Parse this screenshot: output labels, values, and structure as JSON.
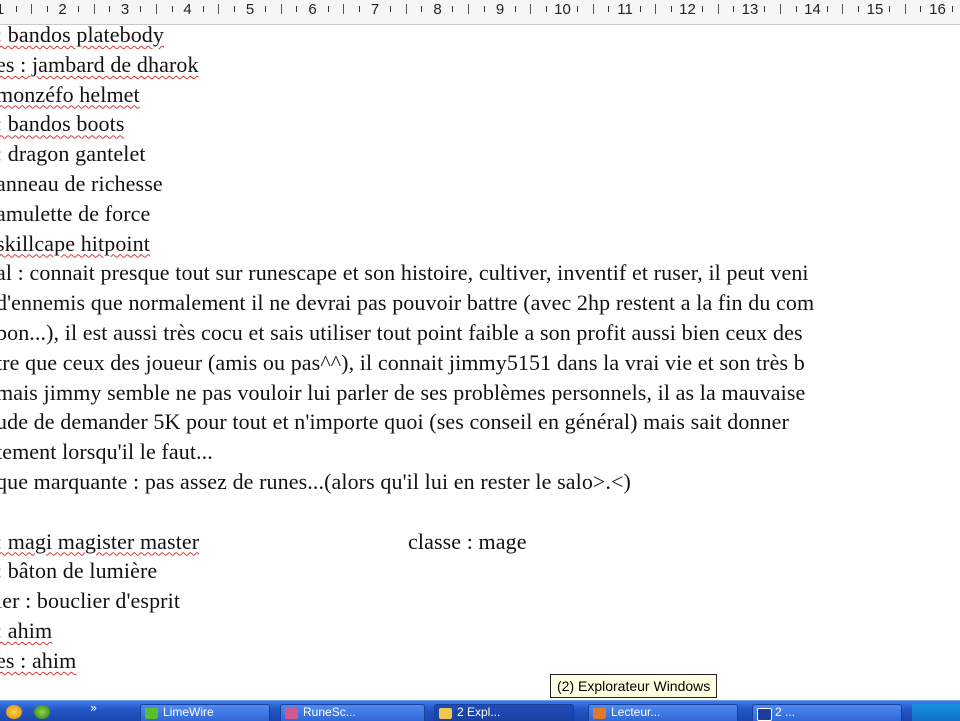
{
  "ruler": {
    "numbers": [
      "1",
      "2",
      "3",
      "4",
      "5",
      "6",
      "7",
      "8",
      "9",
      "10",
      "11",
      "12",
      "13",
      "14",
      "15",
      "16"
    ]
  },
  "document": {
    "lines": [
      {
        "text": ": bandos platebody",
        "squig": true
      },
      {
        "text": "es : jambard de dharok",
        "squig": true
      },
      {
        "text": "monzéfo helmet",
        "squig": true
      },
      {
        "text": ": bandos boots",
        "squig": true
      },
      {
        "text": ": dragon gantelet",
        "squig": false
      },
      {
        "text": "anneau de richesse",
        "squig": false
      },
      {
        "text": "amulette de force",
        "squig": false
      },
      {
        "text": "skillcape hitpoint",
        "squig": true
      },
      {
        "text": "al : connait presque tout sur runescape et son histoire, cultiver, inventif et ruser, il peut veni",
        "squig": false
      },
      {
        "text": "d'ennemis que normalement il ne devrai pas pouvoir battre (avec 2hp restent a la fin du com",
        "squig": false
      },
      {
        "text": "bon...), il est aussi très cocu et sais utiliser tout point faible a son profit aussi bien ceux des",
        "squig": false
      },
      {
        "text": "tre que ceux des joueur (amis ou pas^^), il connait jimmy5151 dans la vrai vie et son très b",
        "squig": false
      },
      {
        "text": "mais jimmy semble ne pas vouloir lui parler de ses problèmes personnels, il as la mauvaise",
        "squig": false
      },
      {
        "text": "ude de demander 5K pour tout et n'importe quoi (ses conseil en général) mais sait donner",
        "squig": false
      },
      {
        "text": "tement lorsqu'il le faut...",
        "squig": false
      },
      {
        "text": "que marquante : pas assez de runes...(alors qu'il lui en rester le salo>.<)",
        "squig": false
      },
      {
        "text": "",
        "squig": false
      },
      {
        "text": ": magi magister master",
        "squig": true,
        "col2": "classe : mage"
      },
      {
        "text": ": bâton de lumière",
        "squig": false
      },
      {
        "text": "ier : bouclier d'esprit",
        "squig": false
      },
      {
        "text": ": ahim",
        "squig": true
      },
      {
        "text": "es : ahim",
        "squig": true
      }
    ]
  },
  "tooltip": {
    "text": "(2) Explorateur Windows"
  },
  "taskbar": {
    "buttons": [
      {
        "label": "LimeWire",
        "icon": "limewire-icon"
      },
      {
        "label": "RuneSc...",
        "icon": "runescape-icon"
      },
      {
        "label": "2 Expl...",
        "icon": "folder-icon"
      },
      {
        "label": "Lecteur...",
        "icon": "media-player-icon"
      },
      {
        "label": "2 ...",
        "icon": "word-icon"
      }
    ]
  }
}
